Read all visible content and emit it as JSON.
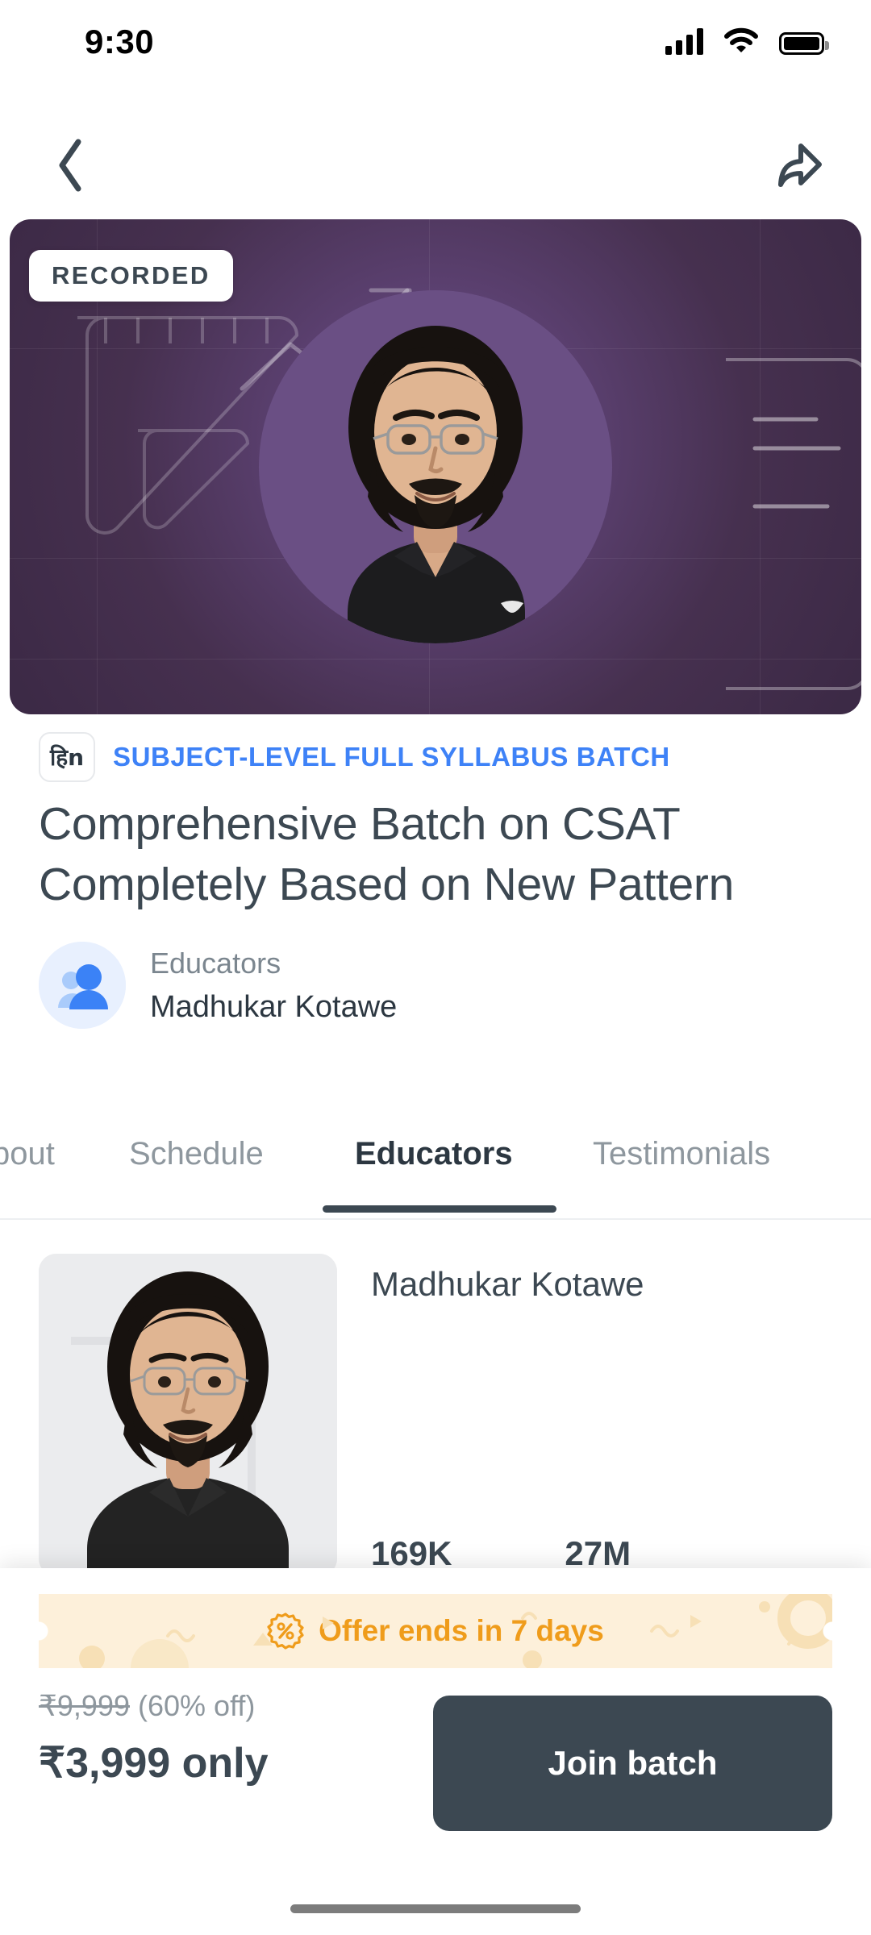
{
  "status_bar": {
    "time": "9:30",
    "signal_icon": "cellular-signal-icon",
    "wifi_icon": "wifi-icon",
    "battery_icon": "battery-icon"
  },
  "nav": {
    "back_icon": "back-chevron-icon",
    "share_icon": "share-arrow-icon"
  },
  "hero": {
    "badge": "RECORDED",
    "background_color": "#4a3457",
    "accent_color": "#6b4f82"
  },
  "meta": {
    "language_badge": "हिn",
    "category": "SUBJECT-LEVEL FULL SYLLABUS BATCH",
    "category_color": "#3e82f7",
    "title": "Comprehensive Batch on CSAT Completely Based on New Pattern",
    "educators_label": "Educators",
    "educator_name": "Madhukar Kotawe",
    "educators_icon": "people-group-icon"
  },
  "tabs": {
    "items": [
      {
        "label": "bout",
        "active": false
      },
      {
        "label": "Schedule",
        "active": false
      },
      {
        "label": "Educators",
        "active": true
      },
      {
        "label": "Testimonials",
        "active": false
      }
    ]
  },
  "educator_card": {
    "name": "Madhukar Kotawe",
    "stats": [
      {
        "value": "169K"
      },
      {
        "value": "27M"
      }
    ]
  },
  "bottom": {
    "offer_text": "Offer ends in 7 days",
    "offer_icon": "percent-badge-icon",
    "offer_color": "#ef9c1b",
    "offer_bg": "#fdf0da",
    "price_old": "₹9,999",
    "discount": "(60% off)",
    "price_new": "₹3,999 only",
    "join_label": "Join batch",
    "join_bg": "#3c4852"
  }
}
